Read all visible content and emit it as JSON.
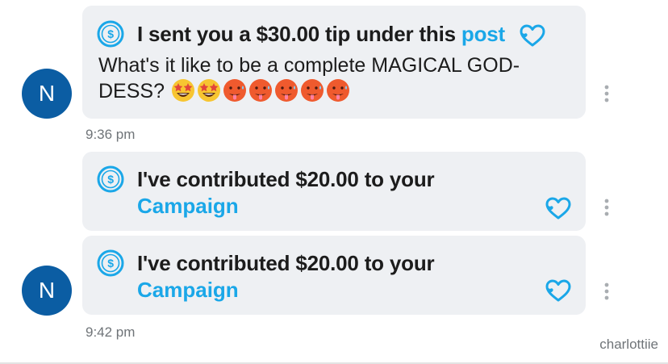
{
  "colors": {
    "avatar_bg": "#0b5da3",
    "bubble_bg": "#eef0f3",
    "link": "#1aa7e8",
    "timestamp": "#6f7478"
  },
  "messages": [
    {
      "avatar_initial": "N",
      "tip_prefix": "I sent you a $30.00 tip under this",
      "tip_link": "post",
      "text_line1": "What's it like to be a complete MAGICAL GOD-",
      "text_line2": "DESS?",
      "emojis": [
        "star-struck-face",
        "star-struck-face",
        "hot-face",
        "hot-face",
        "hot-face",
        "hot-face",
        "hot-face"
      ],
      "timestamp": "9:36 pm"
    },
    {
      "contribution_text": "I've contributed $20.00 to your",
      "contribution_link": "Campaign"
    },
    {
      "avatar_initial": "N",
      "contribution_text": "I've contributed $20.00 to your",
      "contribution_link": "Campaign",
      "timestamp": "9:42 pm"
    }
  ],
  "watermark": "charlottiie"
}
